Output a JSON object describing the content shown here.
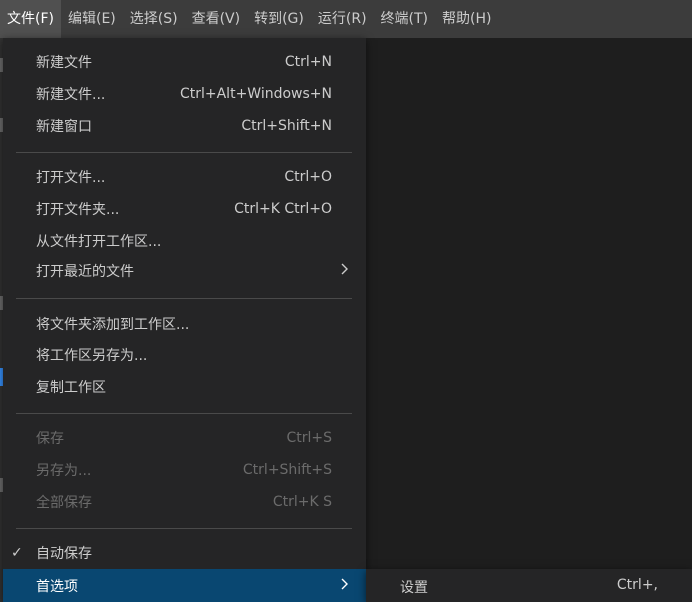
{
  "menubar": {
    "items": [
      {
        "label": "文件(F)"
      },
      {
        "label": "编辑(E)"
      },
      {
        "label": "选择(S)"
      },
      {
        "label": "查看(V)"
      },
      {
        "label": "转到(G)"
      },
      {
        "label": "运行(R)"
      },
      {
        "label": "终端(T)"
      },
      {
        "label": "帮助(H)"
      }
    ]
  },
  "file_menu": {
    "items": [
      {
        "label": "新建文件",
        "shortcut": "Ctrl+N"
      },
      {
        "label": "新建文件...",
        "shortcut": "Ctrl+Alt+Windows+N"
      },
      {
        "label": "新建窗口",
        "shortcut": "Ctrl+Shift+N"
      },
      {
        "label": "打开文件...",
        "shortcut": "Ctrl+O"
      },
      {
        "label": "打开文件夹...",
        "shortcut": "Ctrl+K Ctrl+O"
      },
      {
        "label": "从文件打开工作区..."
      },
      {
        "label": "打开最近的文件"
      },
      {
        "label": "将文件夹添加到工作区..."
      },
      {
        "label": "将工作区另存为..."
      },
      {
        "label": "复制工作区"
      },
      {
        "label": "保存",
        "shortcut": "Ctrl+S"
      },
      {
        "label": "另存为...",
        "shortcut": "Ctrl+Shift+S"
      },
      {
        "label": "全部保存",
        "shortcut": "Ctrl+K S"
      },
      {
        "label": "自动保存",
        "check": "✓"
      },
      {
        "label": "首选项"
      }
    ]
  },
  "preferences_submenu": {
    "items": [
      {
        "label": "设置",
        "shortcut": "Ctrl+,"
      }
    ]
  },
  "icons": {
    "submenu_arrow": "chevron-right-icon",
    "check": "checkmark-icon"
  },
  "colors": {
    "menubar_bg": "#3c3c3c",
    "menu_bg": "#252526",
    "selected_bg": "#094771",
    "editor_bg": "#1e1e1e",
    "disabled_text": "#6b6b6b"
  }
}
